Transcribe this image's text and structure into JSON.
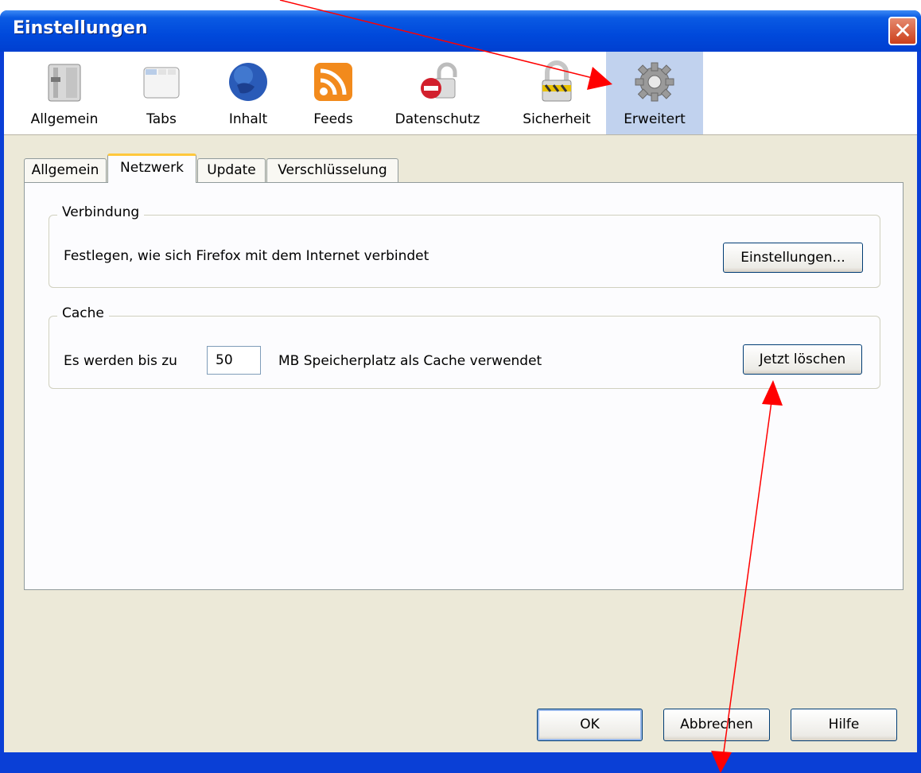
{
  "window": {
    "title": "Einstellungen"
  },
  "toolbar": {
    "items": [
      {
        "label": "Allgemein",
        "icon": "general-switch-icon"
      },
      {
        "label": "Tabs",
        "icon": "tabs-window-icon"
      },
      {
        "label": "Inhalt",
        "icon": "globe-icon"
      },
      {
        "label": "Feeds",
        "icon": "rss-feed-icon"
      },
      {
        "label": "Datenschutz",
        "icon": "privacy-lock-icon"
      },
      {
        "label": "Sicherheit",
        "icon": "security-padlock-icon"
      },
      {
        "label": "Erweitert",
        "icon": "gear-icon",
        "active": true
      }
    ]
  },
  "tabs": [
    {
      "label": "Allgemein"
    },
    {
      "label": "Netzwerk",
      "active": true
    },
    {
      "label": "Update"
    },
    {
      "label": "Verschlüsselung"
    }
  ],
  "connection": {
    "legend": "Verbindung",
    "description": "Festlegen, wie sich Firefox mit dem Internet verbindet",
    "button": "Einstellungen..."
  },
  "cache": {
    "legend": "Cache",
    "prefix": "Es werden bis zu",
    "value": "50",
    "suffix": "MB Speicherplatz als Cache verwendet",
    "button": "Jetzt löschen"
  },
  "footer": {
    "ok": "OK",
    "cancel": "Abbrechen",
    "help": "Hilfe"
  },
  "colors": {
    "title_bar": "#0049db",
    "active_toolbar": "#c1d2ee",
    "active_tab_accent": "#ffc83c",
    "annotation": "#ff0000"
  }
}
